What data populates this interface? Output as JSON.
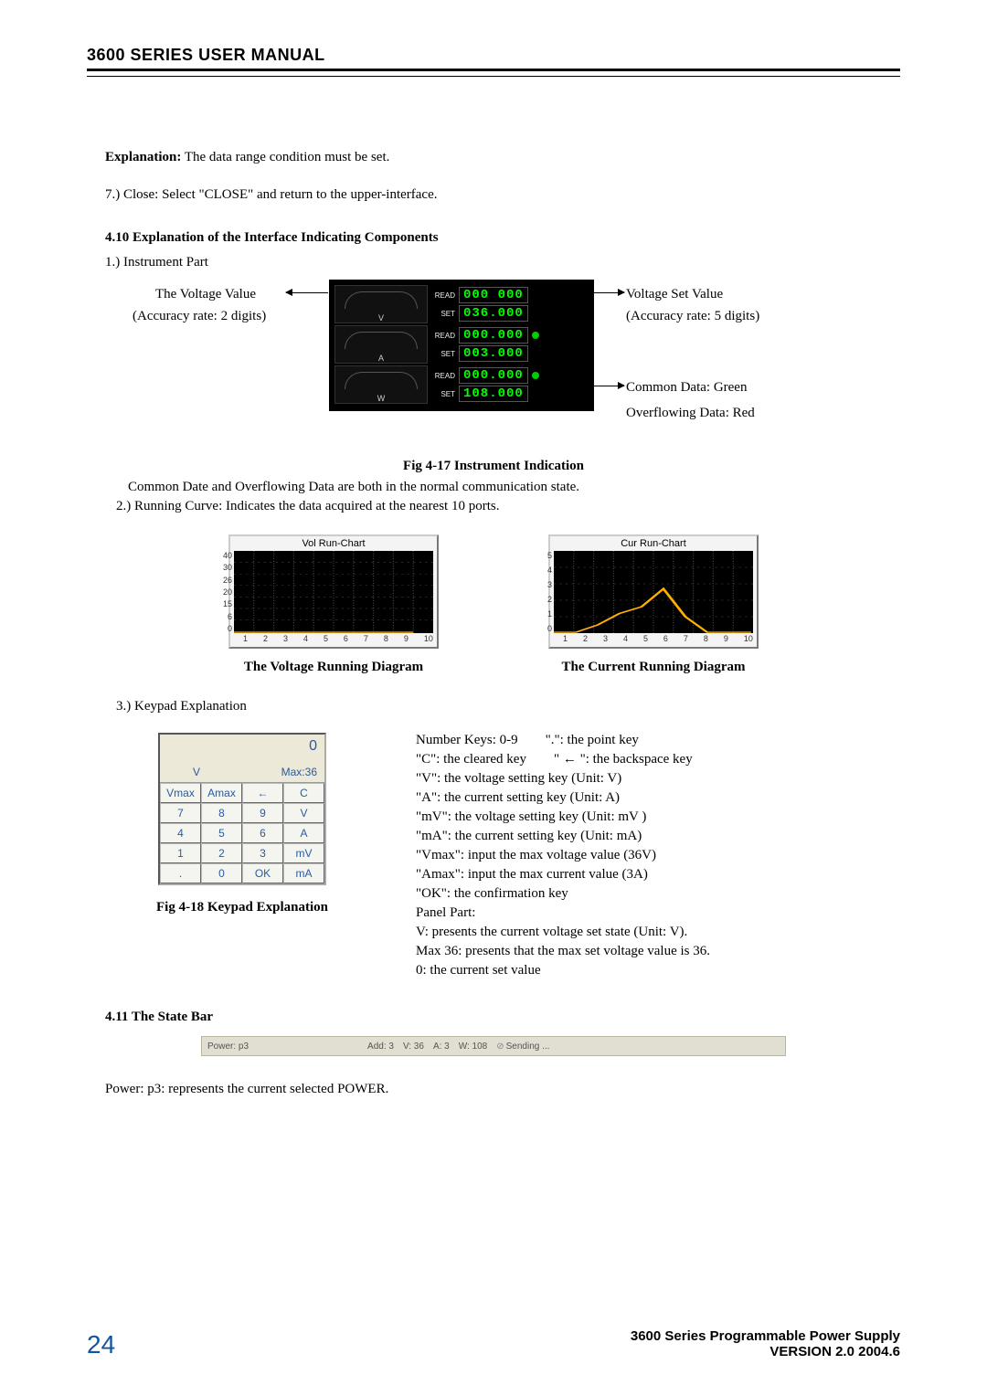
{
  "header": {
    "title": "3600 SERIES USER MANUAL"
  },
  "intro": {
    "expl_label": "Explanation:",
    "expl_text": "  The data range condition must be set.",
    "step7": "7.)  Close: Select \"CLOSE\" and return to the upper-interface."
  },
  "sec410": {
    "title": "4.10  Explanation of the Interface Indicating Components",
    "item1": "1.)  Instrument Part",
    "left_ann_1": "The Voltage Value",
    "left_ann_2": "(Accuracy rate: 2 digits)",
    "right_ann_1": "Voltage Set Value",
    "right_ann_2": "(Accuracy rate: 5 digits)",
    "right_ann_3": "Common Data: Green",
    "right_ann_4": "Overflowing Data: Red",
    "gauge_v": "V",
    "gauge_a": "A",
    "gauge_w": "W",
    "readv": "000 000",
    "setv": "036.000",
    "reada": "000.000",
    "seta": "003.000",
    "readw": "000.000",
    "setw": "108.000",
    "tag_read": "READ",
    "tag_set": "SET",
    "fig_caption": "Fig 4-17 Instrument Indication",
    "post1": "Common Date and Overflowing Data are both in the normal communication state.",
    "post2": "2.)  Running Curve: Indicates the data acquired at the nearest 10 ports."
  },
  "charts": {
    "vol_title": "Vol Run-Chart",
    "cur_title": "Cur Run-Chart",
    "vol_caption": "The Voltage Running Diagram",
    "cur_caption": "The Current Running Diagram",
    "x_ticks": [
      "1",
      "2",
      "3",
      "4",
      "5",
      "6",
      "7",
      "8",
      "9",
      "10"
    ],
    "vol_y_ticks": [
      "40",
      "30",
      "26",
      "20",
      "15",
      "6",
      "0"
    ],
    "cur_y_ticks": [
      "5",
      "4",
      "3",
      "2",
      "1",
      "0"
    ]
  },
  "chart_data": [
    {
      "type": "line",
      "title": "Vol Run-Chart",
      "xlabel": "",
      "ylabel": "",
      "x": [
        1,
        2,
        3,
        4,
        5,
        6,
        7,
        8,
        9,
        10
      ],
      "y": [
        0,
        0,
        0,
        0,
        0,
        0,
        0,
        0,
        0,
        0
      ],
      "ylim": [
        0,
        40
      ],
      "y_ticks": [
        0,
        6,
        15,
        20,
        26,
        30,
        40
      ]
    },
    {
      "type": "line",
      "title": "Cur Run-Chart",
      "xlabel": "",
      "ylabel": "",
      "x": [
        1,
        2,
        3,
        4,
        5,
        6,
        7,
        8,
        9,
        10
      ],
      "y": [
        0,
        0,
        0.5,
        1.2,
        1.6,
        2.7,
        1.0,
        0,
        0,
        0
      ],
      "ylim": [
        0,
        5
      ],
      "y_ticks": [
        0,
        1,
        2,
        3,
        4,
        5
      ]
    }
  ],
  "keypad": {
    "item3": "3.)  Keypad Explanation",
    "disp_zero": "0",
    "disp_v": "V",
    "disp_max": "Max:36",
    "rows": [
      [
        "Vmax",
        "Amax",
        "←",
        "C"
      ],
      [
        "7",
        "8",
        "9",
        "V"
      ],
      [
        "4",
        "5",
        "6",
        "A"
      ],
      [
        "1",
        "2",
        "3",
        "mV"
      ],
      [
        ".",
        "0",
        "OK",
        "mA"
      ]
    ],
    "caption": "Fig 4-18 Keypad Explanation",
    "legend": [
      "Number Keys: 0-9        \".\": the point key",
      "\"C\": the cleared key        \" ← \": the backspace key",
      "\"V\": the voltage setting key (Unit: V)",
      "\"A\": the current setting key (Unit: A)",
      "\"mV\": the voltage setting key (Unit: mV )",
      "\"mA\": the current setting key (Unit: mA)",
      "\"Vmax\": input the max voltage value (36V)",
      "\"Amax\": input the max current value (3A)",
      "\"OK\": the confirmation key",
      "Panel Part:",
      "V: presents the current voltage set state (Unit: V).",
      "Max 36: presents that the max set voltage value is 36.",
      "0: the current set value"
    ]
  },
  "sec411": {
    "title": "4.11 The State Bar",
    "sb_power": "Power:  p3",
    "sb_add": "Add:    3",
    "sb_v": "V:   36",
    "sb_a": "A:    3",
    "sb_w": "W:  108",
    "sb_send": "Sending ...",
    "note": "Power: p3: represents the current selected POWER."
  },
  "footer": {
    "page": "24",
    "line1": "3600 Series Programmable Power Supply",
    "line2": "VERSION 2.0  2004.6"
  }
}
